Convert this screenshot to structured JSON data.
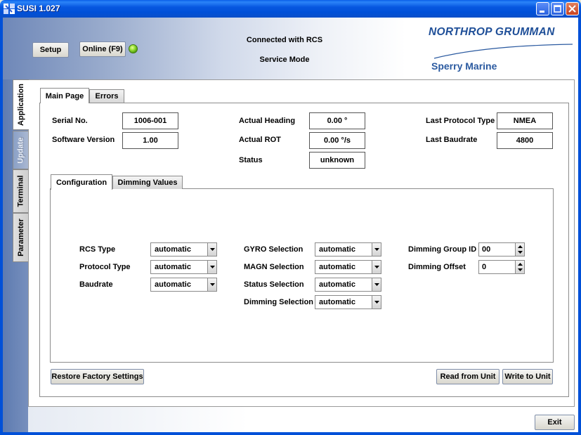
{
  "window": {
    "title": "SUSI 1.027"
  },
  "header": {
    "setup_label": "Setup",
    "online_label": "Online (F9)",
    "connection_status": "Connected with RCS",
    "mode": "Service Mode",
    "brand_primary": "NORTHROP GRUMMAN",
    "brand_secondary": "Sperry Marine"
  },
  "side_tabs": [
    {
      "label": "Application",
      "active": true
    },
    {
      "label": "Update",
      "disabled": true
    },
    {
      "label": "Terminal"
    },
    {
      "label": "Parameter"
    }
  ],
  "main_tabs": [
    {
      "label": "Main Page",
      "active": true
    },
    {
      "label": "Errors"
    }
  ],
  "info": {
    "serial_label": "Serial No.",
    "serial_value": "1006-001",
    "software_label": "Software Version",
    "software_value": "1.00",
    "heading_label": "Actual Heading",
    "heading_value": "0.00 °",
    "rot_label": "Actual ROT",
    "rot_value": "0.00 °/s",
    "status_label": "Status",
    "status_value": "unknown",
    "protocol_label": "Last Protocol Type",
    "protocol_value": "NMEA",
    "baudrate_label": "Last Baudrate",
    "baudrate_value": "4800"
  },
  "sub_tabs": [
    {
      "label": "Configuration",
      "active": true
    },
    {
      "label": "Dimming Values"
    }
  ],
  "config": {
    "rcs_type_label": "RCS Type",
    "rcs_type_value": "automatic",
    "protocol_type_label": "Protocol Type",
    "protocol_type_value": "automatic",
    "baudrate_label": "Baudrate",
    "baudrate_value": "automatic",
    "gyro_label": "GYRO Selection",
    "gyro_value": "automatic",
    "magn_label": "MAGN Selection",
    "magn_value": "automatic",
    "status_sel_label": "Status Selection",
    "status_sel_value": "automatic",
    "dimming_sel_label": "Dimming Selection",
    "dimming_sel_value": "automatic",
    "dimming_group_label": "Dimming Group ID",
    "dimming_group_value": "00",
    "dimming_offset_label": "Dimming Offset",
    "dimming_offset_value": "0"
  },
  "actions": {
    "restore_label": "Restore Factory Settings",
    "read_label": "Read from Unit",
    "write_label": "Write to Unit",
    "exit_label": "Exit"
  },
  "colors": {
    "titlebar": "#0050d8",
    "brand": "#1f4f98",
    "led_online": "#6cc420"
  }
}
